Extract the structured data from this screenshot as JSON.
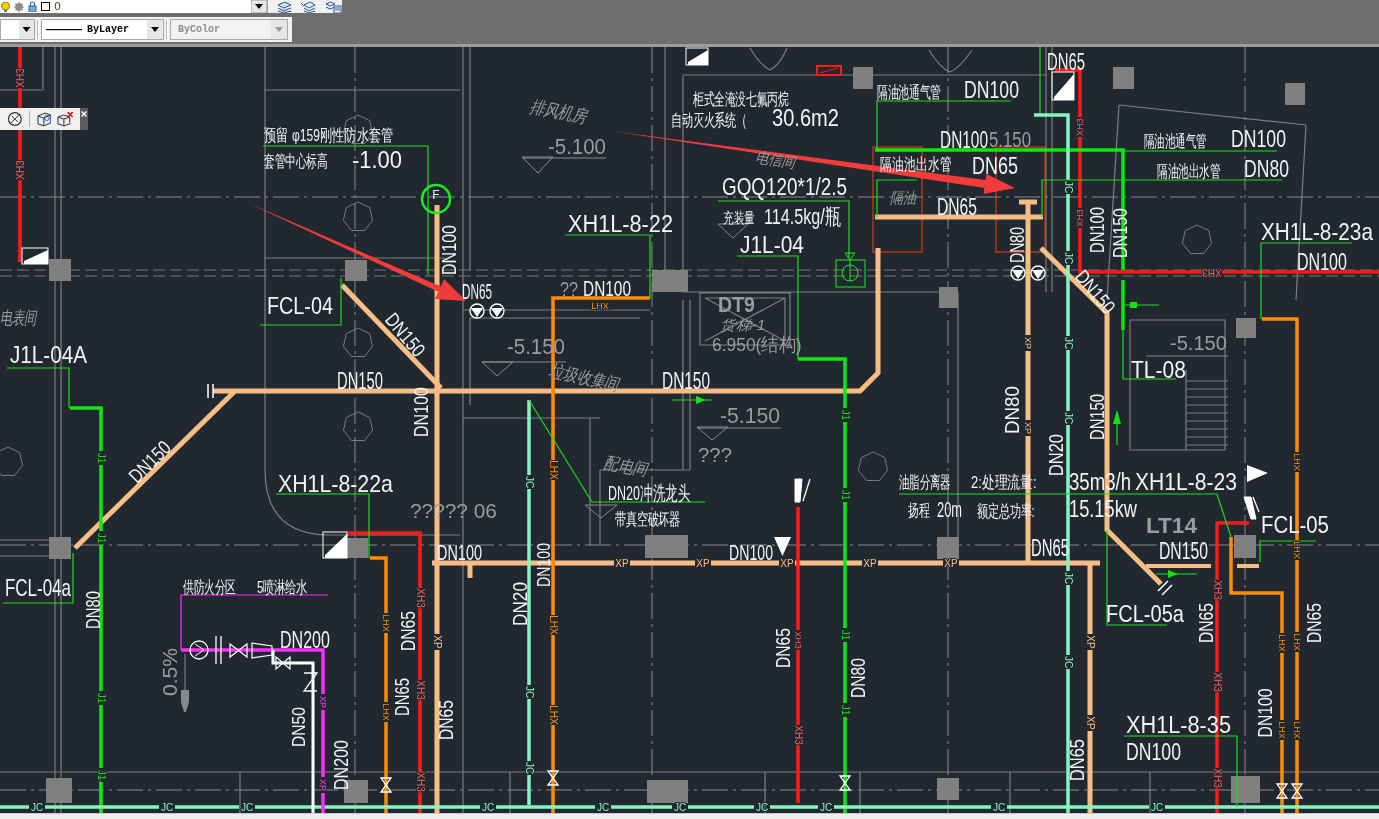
{
  "toolbar": {
    "layer_dropdown": {
      "value": "0"
    },
    "linetype_dropdown": {
      "value": "ByLayer"
    },
    "plot_style_dropdown": {
      "value": "ByColor",
      "disabled": true
    }
  },
  "drawing": {
    "flow_switch": {
      "letter": "F"
    },
    "labels": [
      {
        "text": "预留 φ159刚性防水套管",
        "kind": "note"
      },
      {
        "text": "套管中心标高",
        "kind": "note"
      },
      {
        "text": "-1.00",
        "kind": "note"
      },
      {
        "text": "排风机房",
        "kind": "room"
      },
      {
        "text": "-5.100",
        "kind": "elevation"
      },
      {
        "text": "柜式全淹没七氟丙烷",
        "kind": "note"
      },
      {
        "text": "自动灭火系统（",
        "kind": "note"
      },
      {
        "text": "30.6m2",
        "kind": "note"
      },
      {
        "text": "电信间",
        "kind": "room"
      },
      {
        "text": "GQQ120*1/2.5",
        "kind": "code"
      },
      {
        "text": "充装量",
        "kind": "note"
      },
      {
        "text": "114.5kg/瓶",
        "kind": "note"
      },
      {
        "text": "J1L-04",
        "kind": "code"
      },
      {
        "text": "XH1L-8-22",
        "kind": "code"
      },
      {
        "text": "??",
        "kind": "elevation"
      },
      {
        "text": "DN100",
        "kind": "size"
      },
      {
        "text": "DT9",
        "kind": "marker"
      },
      {
        "text": "货梯-1",
        "kind": "room"
      },
      {
        "text": "-5.150",
        "kind": "elevation"
      },
      {
        "text": "6.950(结构)",
        "kind": "elevation"
      },
      {
        "text": "垃圾收集间",
        "kind": "room"
      },
      {
        "text": "DN150",
        "kind": "size"
      },
      {
        "text": "-5.150",
        "kind": "elevation"
      },
      {
        "text": "配电间",
        "kind": "room"
      },
      {
        "text": "???",
        "kind": "elevation"
      },
      {
        "text": "DN20冲洗龙头",
        "kind": "note"
      },
      {
        "text": "带真空破坏器",
        "kind": "note"
      },
      {
        "text": "DN100",
        "kind": "size"
      },
      {
        "text": "隔油池通气管",
        "kind": "note"
      },
      {
        "text": "DN100",
        "kind": "size"
      },
      {
        "text": "DN65",
        "kind": "size"
      },
      {
        "text": "DN100",
        "kind": "size"
      },
      {
        "text": "5.150",
        "kind": "elevation"
      },
      {
        "text": "隔油池出水管",
        "kind": "note"
      },
      {
        "text": "DN65",
        "kind": "size"
      },
      {
        "text": "隔油",
        "kind": "room"
      },
      {
        "text": "DN65",
        "kind": "size"
      },
      {
        "text": "隔油池通气管",
        "kind": "note"
      },
      {
        "text": "DN100",
        "kind": "size"
      },
      {
        "text": "隔油池出水管",
        "kind": "note"
      },
      {
        "text": "DN80",
        "kind": "size"
      },
      {
        "text": "DN80",
        "kind": "size"
      },
      {
        "text": "DN100",
        "kind": "size"
      },
      {
        "text": "DN150",
        "kind": "size"
      },
      {
        "text": "XH1L-8-23a",
        "kind": "code"
      },
      {
        "text": "DN100",
        "kind": "size"
      },
      {
        "text": "DN150",
        "kind": "size"
      },
      {
        "text": "-5.150",
        "kind": "elevation"
      },
      {
        "text": "TL-08",
        "kind": "code"
      },
      {
        "text": "DN150",
        "kind": "size"
      },
      {
        "text": "电表间",
        "kind": "room"
      },
      {
        "text": "FCL-04",
        "kind": "code"
      },
      {
        "text": "J1L-04A",
        "kind": "code"
      },
      {
        "text": "DN150",
        "kind": "size"
      },
      {
        "text": "DN150",
        "kind": "size"
      },
      {
        "text": "DN100",
        "kind": "size"
      },
      {
        "text": "DN65",
        "kind": "size"
      },
      {
        "text": "DN100",
        "kind": "size"
      },
      {
        "text": "DN150",
        "kind": "size"
      },
      {
        "text": "XH1L-8-22a",
        "kind": "code"
      },
      {
        "text": "????? 06",
        "kind": "elevation"
      },
      {
        "text": "DN100",
        "kind": "size"
      },
      {
        "text": "DN100",
        "kind": "size"
      },
      {
        "text": "FCL-04a",
        "kind": "code"
      },
      {
        "text": "DN80",
        "kind": "size"
      },
      {
        "text": "供防火分区",
        "kind": "note"
      },
      {
        "text": "5喷淋给水",
        "kind": "note"
      },
      {
        "text": "DN20",
        "kind": "size"
      },
      {
        "text": "DN200",
        "kind": "size"
      },
      {
        "text": "0.5%",
        "kind": "elevation"
      },
      {
        "text": "DN65",
        "kind": "size"
      },
      {
        "text": "DN65",
        "kind": "size"
      },
      {
        "text": "DN50",
        "kind": "size"
      },
      {
        "text": "DN65",
        "kind": "size"
      },
      {
        "text": "DN200",
        "kind": "size"
      },
      {
        "text": "DN65",
        "kind": "size"
      },
      {
        "text": "DN80",
        "kind": "size"
      },
      {
        "text": "DN20",
        "kind": "size"
      },
      {
        "text": "DN65",
        "kind": "size"
      },
      {
        "text": "DN80",
        "kind": "size"
      },
      {
        "text": "油脂分离器",
        "kind": "note"
      },
      {
        "text": "2:处理流量:",
        "kind": "note"
      },
      {
        "text": "35m3/h",
        "kind": "note"
      },
      {
        "text": "XH1L-8-23",
        "kind": "code"
      },
      {
        "text": "扬程",
        "kind": "note"
      },
      {
        "text": "20m",
        "kind": "note"
      },
      {
        "text": "额定总功率:",
        "kind": "note"
      },
      {
        "text": "15.15kw",
        "kind": "note"
      },
      {
        "text": "LT14",
        "kind": "marker"
      },
      {
        "text": "FCL-05",
        "kind": "code"
      },
      {
        "text": "DN65",
        "kind": "size"
      },
      {
        "text": "DN150",
        "kind": "size"
      },
      {
        "text": "FCL-05a",
        "kind": "code"
      },
      {
        "text": "DN65",
        "kind": "size"
      },
      {
        "text": "DN65",
        "kind": "size"
      },
      {
        "text": "XH1L-8-35",
        "kind": "code"
      },
      {
        "text": "DN100",
        "kind": "size"
      },
      {
        "text": "DN100",
        "kind": "size"
      }
    ],
    "pipe_tags": [
      {
        "text": "XH3"
      },
      {
        "text": "XH3"
      },
      {
        "text": "XH3"
      },
      {
        "text": "XH3"
      },
      {
        "text": "XH3"
      },
      {
        "text": "XH3"
      },
      {
        "text": "XH3"
      },
      {
        "text": "XH3"
      },
      {
        "text": "XH3"
      },
      {
        "text": "XH3"
      },
      {
        "text": "XH3"
      },
      {
        "text": "XH3"
      },
      {
        "text": "XH3"
      },
      {
        "text": "LHX"
      },
      {
        "text": "LHX"
      },
      {
        "text": "LHX"
      },
      {
        "text": "LHX"
      },
      {
        "text": "LHX"
      },
      {
        "text": "LHX"
      },
      {
        "text": "LHX"
      },
      {
        "text": "LHX"
      },
      {
        "text": "LHX"
      },
      {
        "text": "LHX"
      },
      {
        "text": "LHX"
      },
      {
        "text": "LHX"
      },
      {
        "text": "J1"
      },
      {
        "text": "J1"
      },
      {
        "text": "J1"
      },
      {
        "text": "J1"
      },
      {
        "text": "J1"
      },
      {
        "text": "J1"
      },
      {
        "text": "J1"
      },
      {
        "text": "J1"
      },
      {
        "text": "JC"
      },
      {
        "text": "JC"
      },
      {
        "text": "JC"
      },
      {
        "text": "JC"
      },
      {
        "text": "JC"
      },
      {
        "text": "JC"
      },
      {
        "text": "JC"
      },
      {
        "text": "JC"
      },
      {
        "text": "JC"
      },
      {
        "text": "JC"
      },
      {
        "text": "JC"
      },
      {
        "text": "JC"
      },
      {
        "text": "JC"
      },
      {
        "text": "JC"
      },
      {
        "text": "JC"
      },
      {
        "text": "JC"
      },
      {
        "text": "JC"
      },
      {
        "text": "JC"
      },
      {
        "text": "JC"
      },
      {
        "text": "XP"
      },
      {
        "text": "XP"
      },
      {
        "text": "XP"
      },
      {
        "text": "XP"
      },
      {
        "text": "XP"
      },
      {
        "text": "XP"
      },
      {
        "text": "XP"
      },
      {
        "text": "XP"
      },
      {
        "text": "XP"
      },
      {
        "text": "XP"
      },
      {
        "text": "XP"
      },
      {
        "text": "XP"
      }
    ]
  }
}
